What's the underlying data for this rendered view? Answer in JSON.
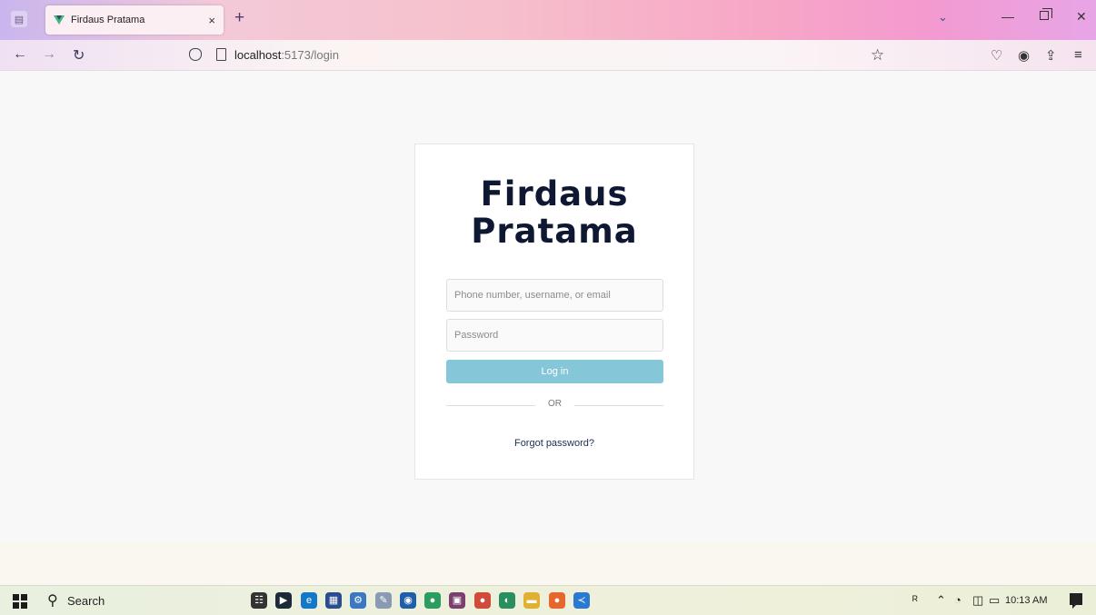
{
  "browser": {
    "tab": {
      "title": "Firdaus Pratama",
      "close": "×"
    },
    "new_tab": "+",
    "url": {
      "host": "localhost",
      "path": ":5173/login"
    }
  },
  "login": {
    "brand_line1": "Firdaus",
    "brand_line2": "Pratama",
    "username_placeholder": "Phone number, username, or email",
    "password_placeholder": "Password",
    "login_label": "Log in",
    "or_text": "OR",
    "forgot_label": "Forgot password?"
  },
  "taskbar": {
    "search_label": "Search",
    "time": "10:13 AM",
    "apps": [
      {
        "name": "task-view",
        "color": "#333333",
        "glyph": "☷"
      },
      {
        "name": "terminal",
        "color": "#1e2a3a",
        "glyph": "▶"
      },
      {
        "name": "edge",
        "color": "#1577c7",
        "glyph": "e"
      },
      {
        "name": "calculator",
        "color": "#2a4d8e",
        "glyph": "▦"
      },
      {
        "name": "settings",
        "color": "#3a78c2",
        "glyph": "⚙"
      },
      {
        "name": "paint",
        "color": "#8a9ab2",
        "glyph": "✎"
      },
      {
        "name": "store",
        "color": "#1f5fa8",
        "glyph": "◉"
      },
      {
        "name": "chrome",
        "color": "#2a9d5f",
        "glyph": "●"
      },
      {
        "name": "winrar",
        "color": "#7b3f6f",
        "glyph": "▣"
      },
      {
        "name": "app-red",
        "color": "#d14a3a",
        "glyph": "●"
      },
      {
        "name": "chrome-2",
        "color": "#2a8f5f",
        "glyph": "◐"
      },
      {
        "name": "explorer",
        "color": "#e0b030",
        "glyph": "▬"
      },
      {
        "name": "firefox",
        "color": "#e7662b",
        "glyph": "●"
      },
      {
        "name": "vscode",
        "color": "#2a7ad1",
        "glyph": "≺"
      }
    ]
  },
  "colors": {
    "brand_text": "#0f1833",
    "login_button": "#85c6d8",
    "forgot_link": "#1b2f52"
  }
}
